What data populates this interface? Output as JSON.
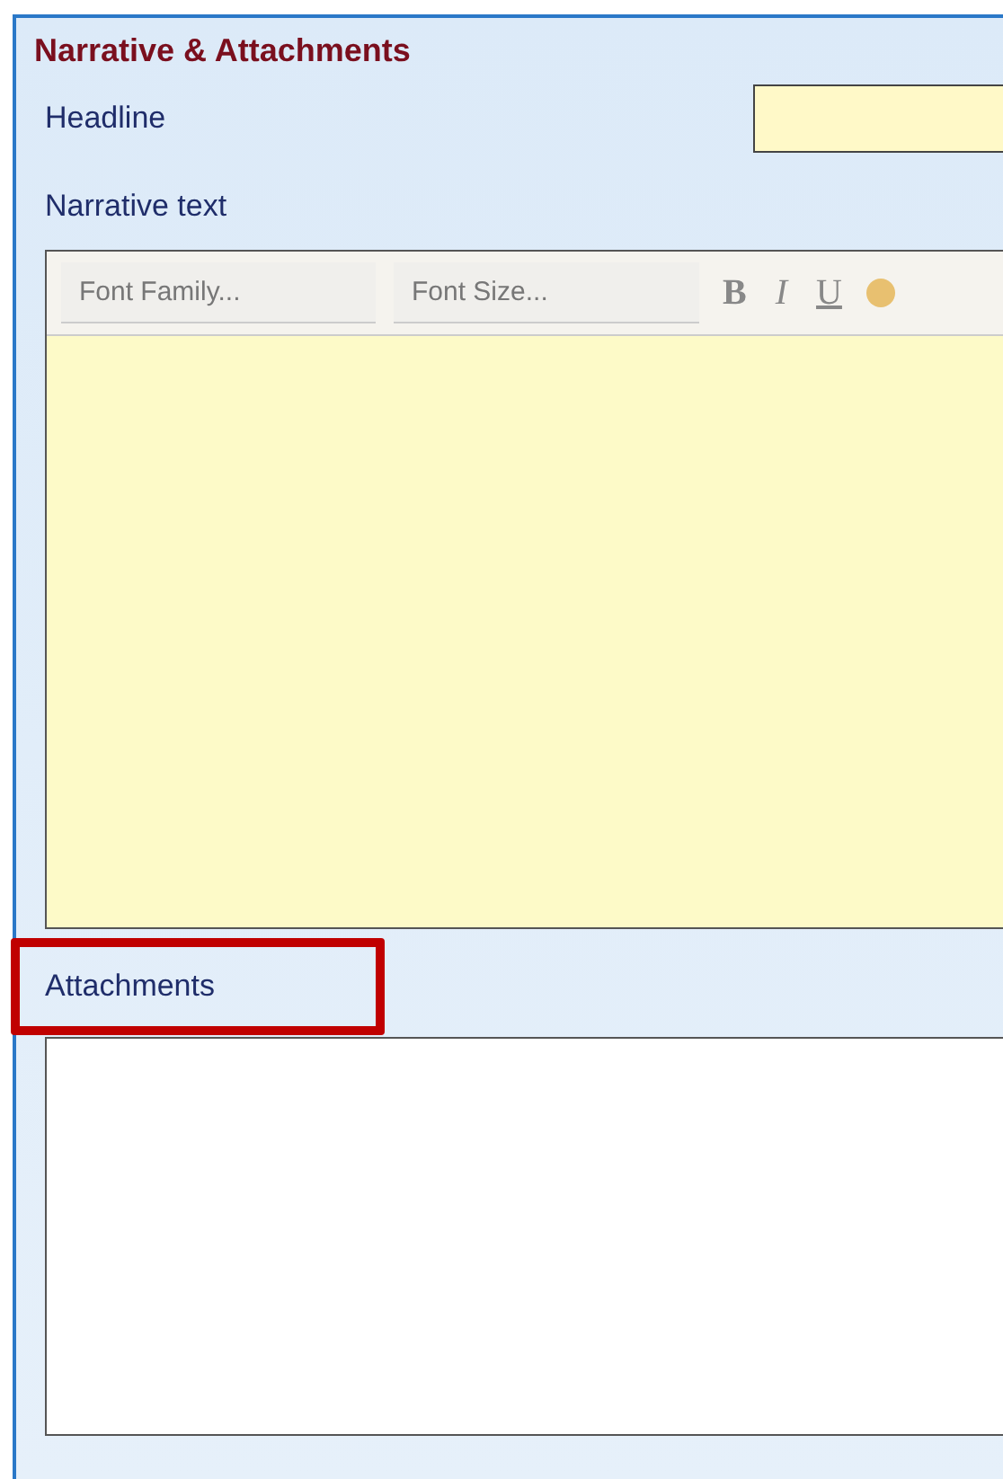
{
  "section": {
    "title": "Narrative & Attachments"
  },
  "headline": {
    "label": "Headline"
  },
  "narrative": {
    "label": "Narrative text",
    "toolbar": {
      "dropdowns": [
        {
          "placeholder": "Font Family..."
        },
        {
          "placeholder": "Font Size..."
        }
      ],
      "buttons": [
        {
          "kind": "bold",
          "glyph": "B"
        },
        {
          "kind": "italic",
          "glyph": "I"
        },
        {
          "kind": "underline",
          "glyph": "U"
        },
        {
          "kind": "color"
        }
      ]
    }
  },
  "attachments": {
    "label": "Attachments",
    "highlighted": true
  }
}
